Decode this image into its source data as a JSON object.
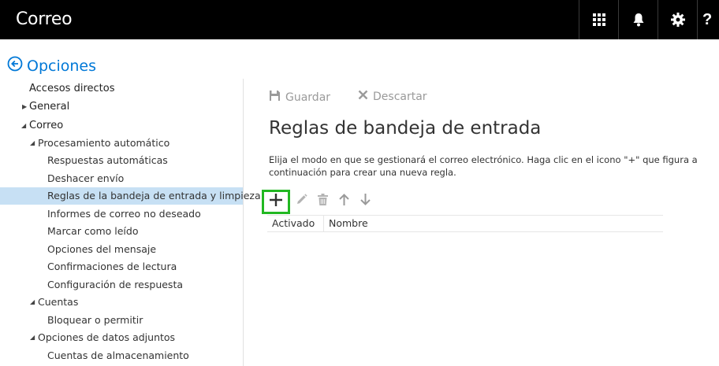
{
  "header": {
    "app_title": "Correo",
    "icons": [
      "app-launcher-icon",
      "bell-icon",
      "gear-icon",
      "help-icon"
    ],
    "help_glyph": "?"
  },
  "back": {
    "label": "Opciones",
    "icon": "back-arrow-circle-icon"
  },
  "sidebar": {
    "items": [
      {
        "label": "Accesos directos"
      },
      {
        "label": "General"
      },
      {
        "label": "Correo"
      },
      {
        "label": "Procesamiento automático"
      },
      {
        "label": "Respuestas automáticas"
      },
      {
        "label": "Deshacer envío"
      },
      {
        "label": "Reglas de la bandeja de entrada y limpieza",
        "selected": true
      },
      {
        "label": "Informes de correo no deseado"
      },
      {
        "label": "Marcar como leído"
      },
      {
        "label": "Opciones del mensaje"
      },
      {
        "label": "Confirmaciones de lectura"
      },
      {
        "label": "Configuración de respuesta"
      },
      {
        "label": "Cuentas"
      },
      {
        "label": "Bloquear o permitir"
      },
      {
        "label": "Opciones de datos adjuntos"
      },
      {
        "label": "Cuentas de almacenamiento"
      }
    ]
  },
  "main": {
    "save_label": "Guardar",
    "discard_label": "Descartar",
    "title": "Reglas de bandeja de entrada",
    "description": "Elija el modo en que se gestionará el correo electrónico. Haga clic en el icono \"+\" que figura a continuación para crear una nueva regla.",
    "toolbar_icons": [
      "add-icon",
      "edit-pencil-icon",
      "delete-trash-icon",
      "move-up-arrow-icon",
      "move-down-arrow-icon"
    ],
    "table": {
      "columns": [
        "Activado",
        "Nombre"
      ]
    }
  },
  "colors": {
    "topbar": "#000000",
    "link_blue": "#0078d7",
    "selected_bg": "#c7e0f4",
    "add_highlight": "#22b822",
    "disabled_gray": "#9a9a9a"
  }
}
